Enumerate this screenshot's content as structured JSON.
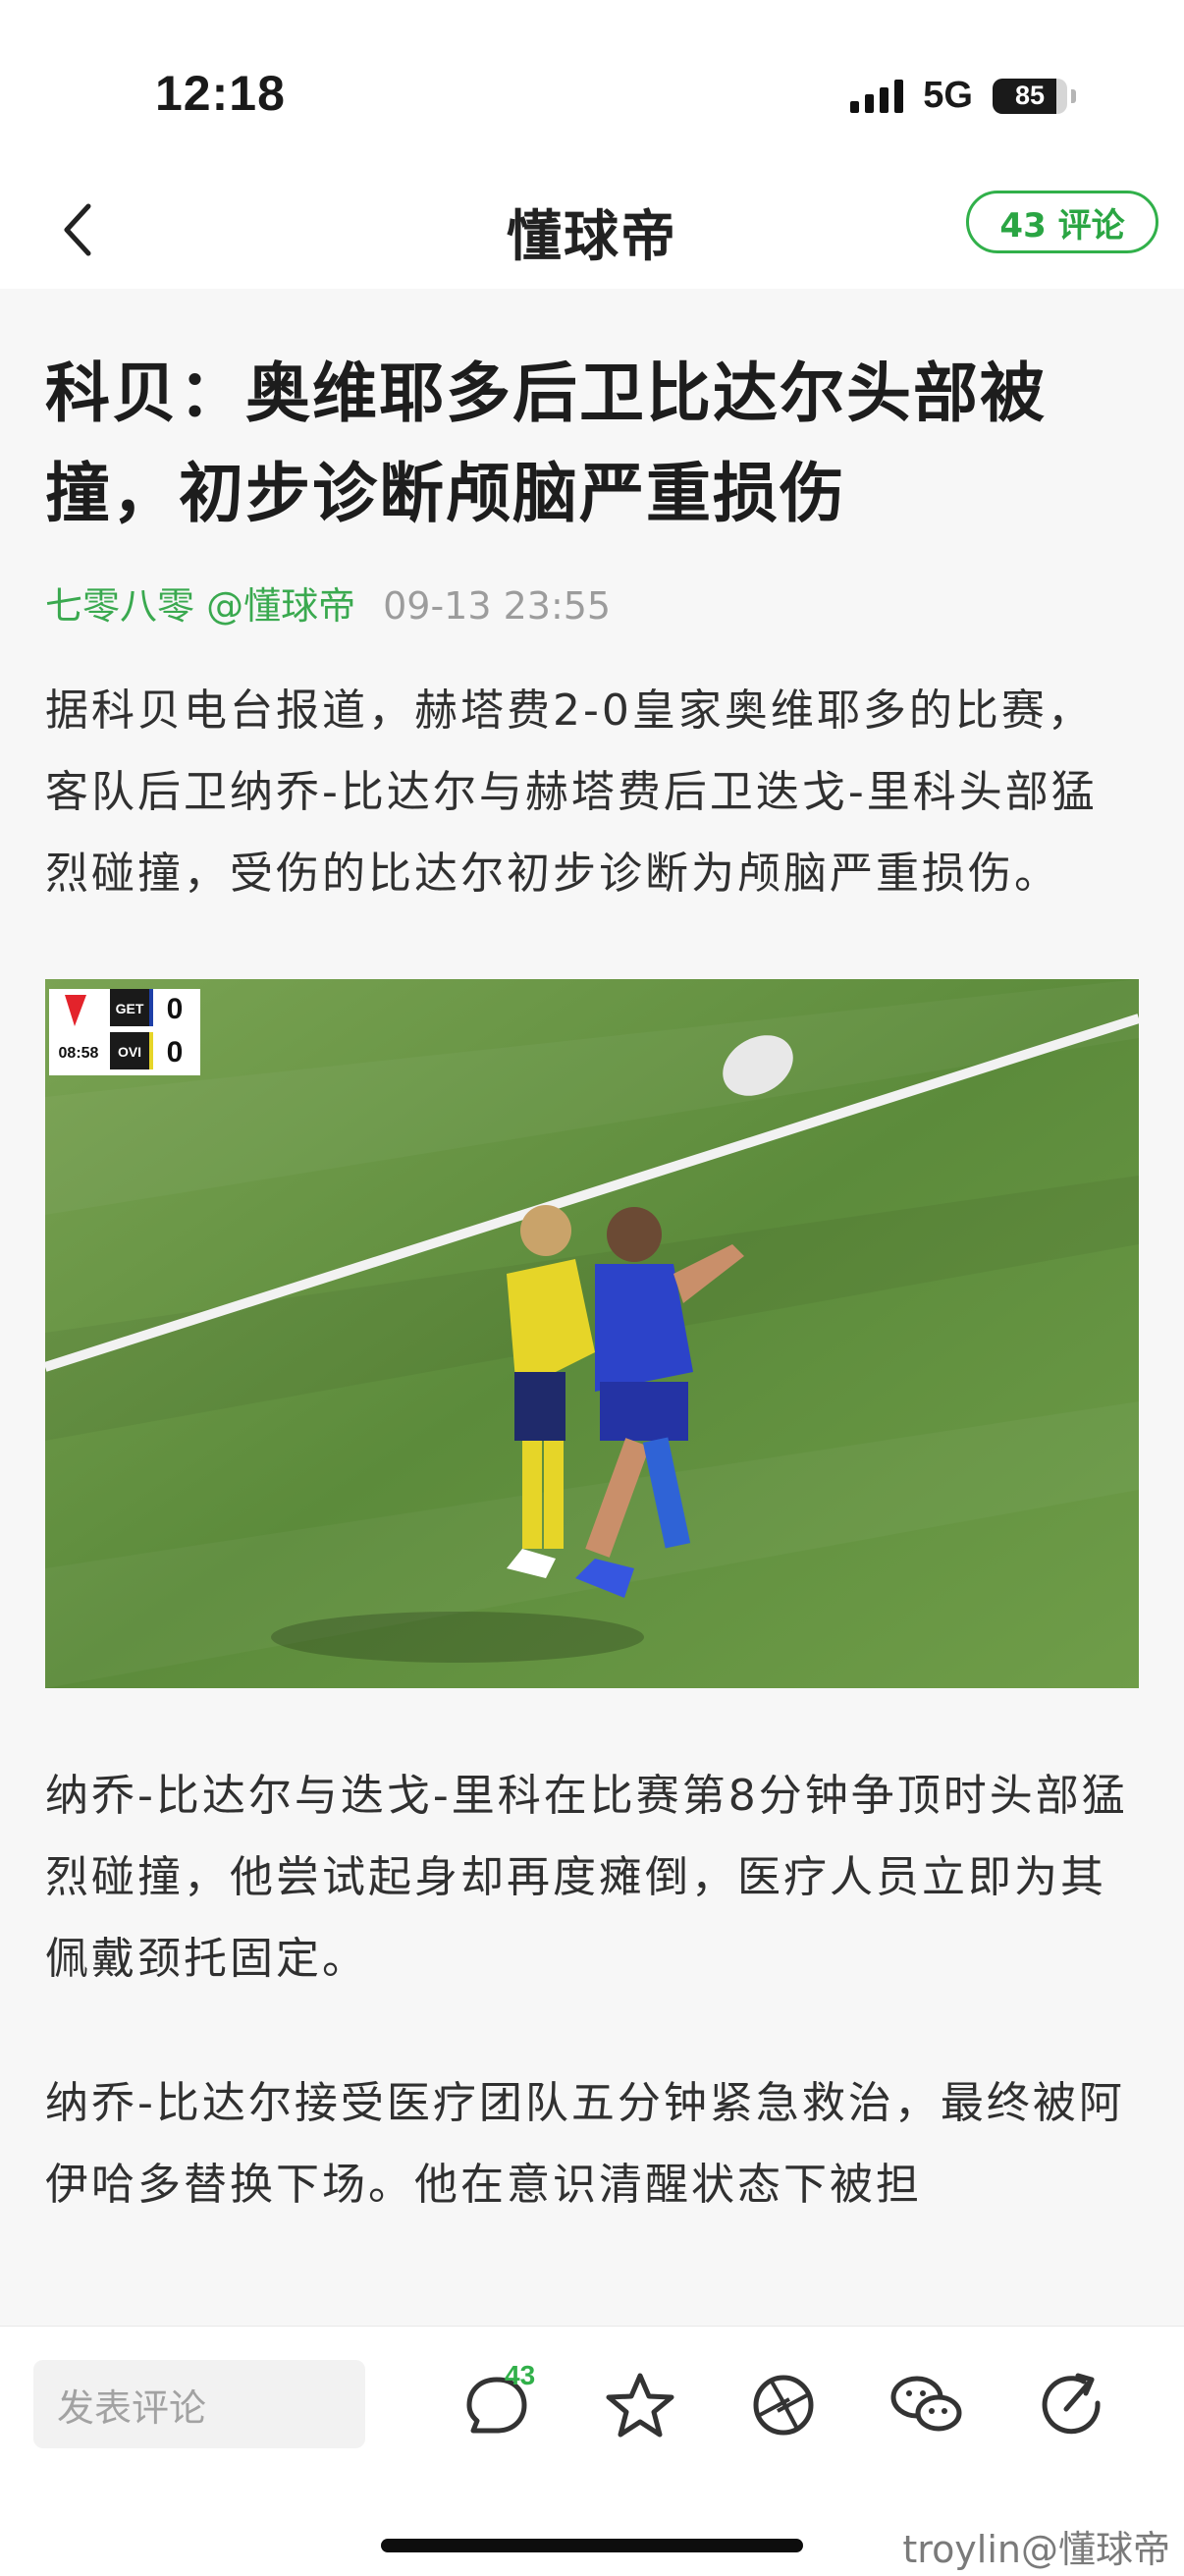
{
  "status_bar": {
    "time": "12:18",
    "network": "5G",
    "battery": "85",
    "battery_level": 0.85
  },
  "nav": {
    "back_icon": "chevron-left-icon",
    "title": "懂球帝",
    "comment_button": "43 评论"
  },
  "article": {
    "title": "科贝：奥维耶多后卫比达尔头部被撞，初步诊断颅脑严重损伤",
    "author": "七零八零 @懂球帝",
    "timestamp": "09-13 23:55",
    "paragraphs": [
      "据科贝电台报道，赫塔费2-0皇家奥维耶多的比赛，客队后卫纳乔-比达尔与赫塔费后卫迭戈-里科头部猛烈碰撞，受伤的比达尔初步诊断为颅脑严重损伤。",
      "纳乔-比达尔与迭戈-里科在比赛第8分钟争顶时头部猛烈碰撞，他尝试起身却再度瘫倒，医疗人员立即为其佩戴颈托固定。",
      "纳乔-比达尔接受医疗团队五分钟紧急救治，最终被阿伊哈多替换下场。他在意识清醒状态下被担"
    ],
    "scorebug": {
      "clock": "08:58",
      "team1": "GET",
      "score1": "0",
      "team2": "OVI",
      "score2": "0"
    }
  },
  "bottom_bar": {
    "comment_placeholder": "发表评论",
    "comment_count": "43",
    "icons": [
      "comment-icon",
      "star-icon",
      "shutter-icon",
      "wechat-icon",
      "share-icon"
    ]
  },
  "watermark": "troylin@懂球帝",
  "colors": {
    "accent_green": "#31b04a",
    "author_green": "#3aa94f",
    "text": "#303030"
  }
}
